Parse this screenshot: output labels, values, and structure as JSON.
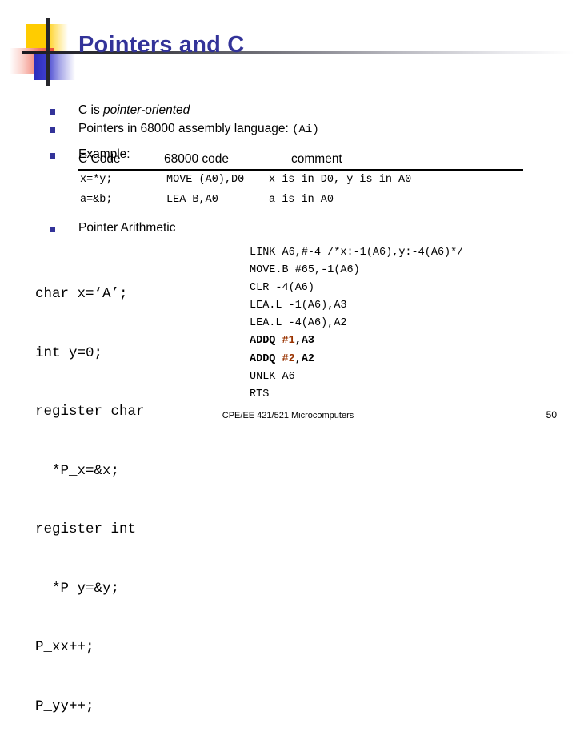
{
  "slide": {
    "title": "Pointers and C",
    "title_color": "#333399",
    "bullet_color": "#333399"
  },
  "bullets": [
    {
      "prefix": "C is ",
      "emphasis": "pointer-oriented",
      "suffix": "",
      "mono": ""
    },
    {
      "prefix": "Pointers in 68000 assembly language: ",
      "emphasis": "",
      "suffix": "",
      "mono": "(Ai)"
    },
    {
      "prefix": "Example:",
      "emphasis": "",
      "suffix": "",
      "mono": ""
    },
    {
      "prefix": "Pointer Arithmetic",
      "emphasis": "",
      "suffix": "",
      "mono": ""
    }
  ],
  "code_table": {
    "headers": [
      "C Code",
      "68000 code",
      "comment"
    ],
    "rows": [
      [
        "x=*y;",
        "MOVE (A0),D0",
        "x is in D0, y is in A0"
      ],
      [
        "a=&b;",
        "LEA B,A0",
        "a is in A0"
      ]
    ]
  },
  "c_code_block": {
    "lines": [
      "char x=‘A’;",
      "int y=0;",
      "register char",
      "  *P_x=&x;",
      "register int",
      "  *P_y=&y;",
      "P_xx++;",
      "P_yy++;"
    ]
  },
  "asm_code_block": {
    "immediate_color": "#993300",
    "lines": [
      {
        "pre": "LINK A6,#-4 /*x:-1(A6),y:-4(A6)*/",
        "imm": "",
        "post": "",
        "bold": false
      },
      {
        "pre": "MOVE.B #65,-1(A6)",
        "imm": "",
        "post": "",
        "bold": false
      },
      {
        "pre": "CLR -4(A6)",
        "imm": "",
        "post": "",
        "bold": false
      },
      {
        "pre": "LEA.L -1(A6),A3",
        "imm": "",
        "post": "",
        "bold": false
      },
      {
        "pre": "LEA.L -4(A6),A2",
        "imm": "",
        "post": "",
        "bold": false
      },
      {
        "pre": "ADDQ ",
        "imm": "#1",
        "post": ",A3",
        "bold": true
      },
      {
        "pre": "ADDQ ",
        "imm": "#2",
        "post": ",A2",
        "bold": true
      },
      {
        "pre": "UNLK A6",
        "imm": "",
        "post": "",
        "bold": false
      },
      {
        "pre": "RTS",
        "imm": "",
        "post": "",
        "bold": false
      }
    ]
  },
  "footer": {
    "course": "CPE/EE 421/521 Microcomputers",
    "page_number": "50"
  }
}
